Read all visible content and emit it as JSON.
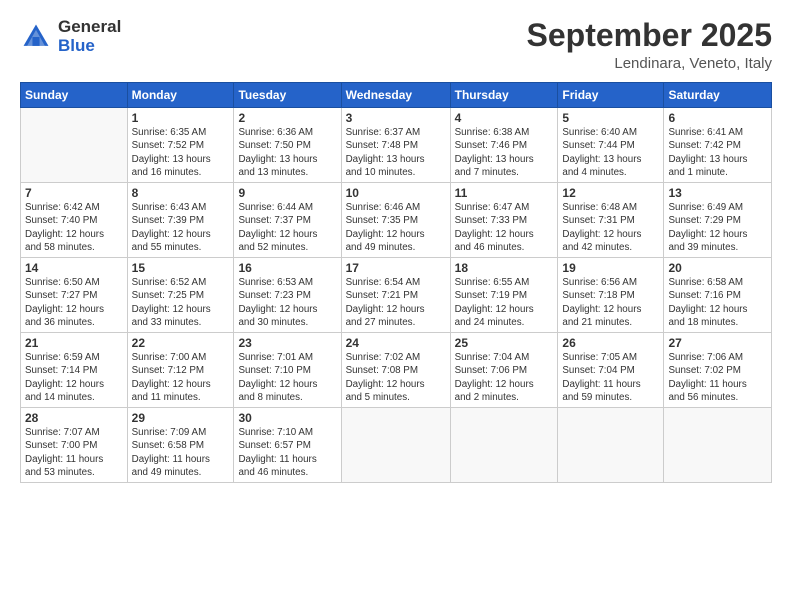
{
  "logo": {
    "general": "General",
    "blue": "Blue"
  },
  "title": "September 2025",
  "location": "Lendinara, Veneto, Italy",
  "days_of_week": [
    "Sunday",
    "Monday",
    "Tuesday",
    "Wednesday",
    "Thursday",
    "Friday",
    "Saturday"
  ],
  "weeks": [
    [
      {
        "day": "",
        "info": ""
      },
      {
        "day": "1",
        "info": "Sunrise: 6:35 AM\nSunset: 7:52 PM\nDaylight: 13 hours\nand 16 minutes."
      },
      {
        "day": "2",
        "info": "Sunrise: 6:36 AM\nSunset: 7:50 PM\nDaylight: 13 hours\nand 13 minutes."
      },
      {
        "day": "3",
        "info": "Sunrise: 6:37 AM\nSunset: 7:48 PM\nDaylight: 13 hours\nand 10 minutes."
      },
      {
        "day": "4",
        "info": "Sunrise: 6:38 AM\nSunset: 7:46 PM\nDaylight: 13 hours\nand 7 minutes."
      },
      {
        "day": "5",
        "info": "Sunrise: 6:40 AM\nSunset: 7:44 PM\nDaylight: 13 hours\nand 4 minutes."
      },
      {
        "day": "6",
        "info": "Sunrise: 6:41 AM\nSunset: 7:42 PM\nDaylight: 13 hours\nand 1 minute."
      }
    ],
    [
      {
        "day": "7",
        "info": "Sunrise: 6:42 AM\nSunset: 7:40 PM\nDaylight: 12 hours\nand 58 minutes."
      },
      {
        "day": "8",
        "info": "Sunrise: 6:43 AM\nSunset: 7:39 PM\nDaylight: 12 hours\nand 55 minutes."
      },
      {
        "day": "9",
        "info": "Sunrise: 6:44 AM\nSunset: 7:37 PM\nDaylight: 12 hours\nand 52 minutes."
      },
      {
        "day": "10",
        "info": "Sunrise: 6:46 AM\nSunset: 7:35 PM\nDaylight: 12 hours\nand 49 minutes."
      },
      {
        "day": "11",
        "info": "Sunrise: 6:47 AM\nSunset: 7:33 PM\nDaylight: 12 hours\nand 46 minutes."
      },
      {
        "day": "12",
        "info": "Sunrise: 6:48 AM\nSunset: 7:31 PM\nDaylight: 12 hours\nand 42 minutes."
      },
      {
        "day": "13",
        "info": "Sunrise: 6:49 AM\nSunset: 7:29 PM\nDaylight: 12 hours\nand 39 minutes."
      }
    ],
    [
      {
        "day": "14",
        "info": "Sunrise: 6:50 AM\nSunset: 7:27 PM\nDaylight: 12 hours\nand 36 minutes."
      },
      {
        "day": "15",
        "info": "Sunrise: 6:52 AM\nSunset: 7:25 PM\nDaylight: 12 hours\nand 33 minutes."
      },
      {
        "day": "16",
        "info": "Sunrise: 6:53 AM\nSunset: 7:23 PM\nDaylight: 12 hours\nand 30 minutes."
      },
      {
        "day": "17",
        "info": "Sunrise: 6:54 AM\nSunset: 7:21 PM\nDaylight: 12 hours\nand 27 minutes."
      },
      {
        "day": "18",
        "info": "Sunrise: 6:55 AM\nSunset: 7:19 PM\nDaylight: 12 hours\nand 24 minutes."
      },
      {
        "day": "19",
        "info": "Sunrise: 6:56 AM\nSunset: 7:18 PM\nDaylight: 12 hours\nand 21 minutes."
      },
      {
        "day": "20",
        "info": "Sunrise: 6:58 AM\nSunset: 7:16 PM\nDaylight: 12 hours\nand 18 minutes."
      }
    ],
    [
      {
        "day": "21",
        "info": "Sunrise: 6:59 AM\nSunset: 7:14 PM\nDaylight: 12 hours\nand 14 minutes."
      },
      {
        "day": "22",
        "info": "Sunrise: 7:00 AM\nSunset: 7:12 PM\nDaylight: 12 hours\nand 11 minutes."
      },
      {
        "day": "23",
        "info": "Sunrise: 7:01 AM\nSunset: 7:10 PM\nDaylight: 12 hours\nand 8 minutes."
      },
      {
        "day": "24",
        "info": "Sunrise: 7:02 AM\nSunset: 7:08 PM\nDaylight: 12 hours\nand 5 minutes."
      },
      {
        "day": "25",
        "info": "Sunrise: 7:04 AM\nSunset: 7:06 PM\nDaylight: 12 hours\nand 2 minutes."
      },
      {
        "day": "26",
        "info": "Sunrise: 7:05 AM\nSunset: 7:04 PM\nDaylight: 11 hours\nand 59 minutes."
      },
      {
        "day": "27",
        "info": "Sunrise: 7:06 AM\nSunset: 7:02 PM\nDaylight: 11 hours\nand 56 minutes."
      }
    ],
    [
      {
        "day": "28",
        "info": "Sunrise: 7:07 AM\nSunset: 7:00 PM\nDaylight: 11 hours\nand 53 minutes."
      },
      {
        "day": "29",
        "info": "Sunrise: 7:09 AM\nSunset: 6:58 PM\nDaylight: 11 hours\nand 49 minutes."
      },
      {
        "day": "30",
        "info": "Sunrise: 7:10 AM\nSunset: 6:57 PM\nDaylight: 11 hours\nand 46 minutes."
      },
      {
        "day": "",
        "info": ""
      },
      {
        "day": "",
        "info": ""
      },
      {
        "day": "",
        "info": ""
      },
      {
        "day": "",
        "info": ""
      }
    ]
  ]
}
